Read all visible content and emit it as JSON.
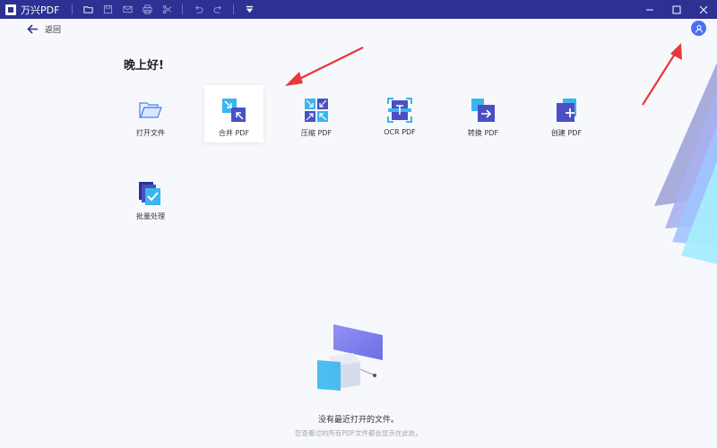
{
  "titlebar": {
    "app_title": "万兴PDF",
    "icons": [
      "folder-icon",
      "save-icon",
      "mail-icon",
      "print-icon",
      "share-icon",
      "undo-icon",
      "redo-icon",
      "menu-down-icon"
    ],
    "colors": {
      "bar": "#2d3193"
    }
  },
  "nav": {
    "back_label": "返回"
  },
  "greeting": "晚上好!",
  "tools": [
    {
      "label": "打开文件",
      "icon": "folder-open-icon"
    },
    {
      "label": "合并 PDF",
      "icon": "merge-icon"
    },
    {
      "label": "压缩 PDF",
      "icon": "compress-icon"
    },
    {
      "label": "OCR PDF",
      "icon": "ocr-icon"
    },
    {
      "label": "转换 PDF",
      "icon": "convert-icon"
    },
    {
      "label": "创建 PDF",
      "icon": "create-icon"
    },
    {
      "label": "批量处理",
      "icon": "batch-icon"
    }
  ],
  "active_tool": "合并 PDF",
  "empty_state": {
    "title": "没有最近打开的文件。",
    "subtitle": "您查看过的所有PDF文件都会显示在此处。"
  }
}
